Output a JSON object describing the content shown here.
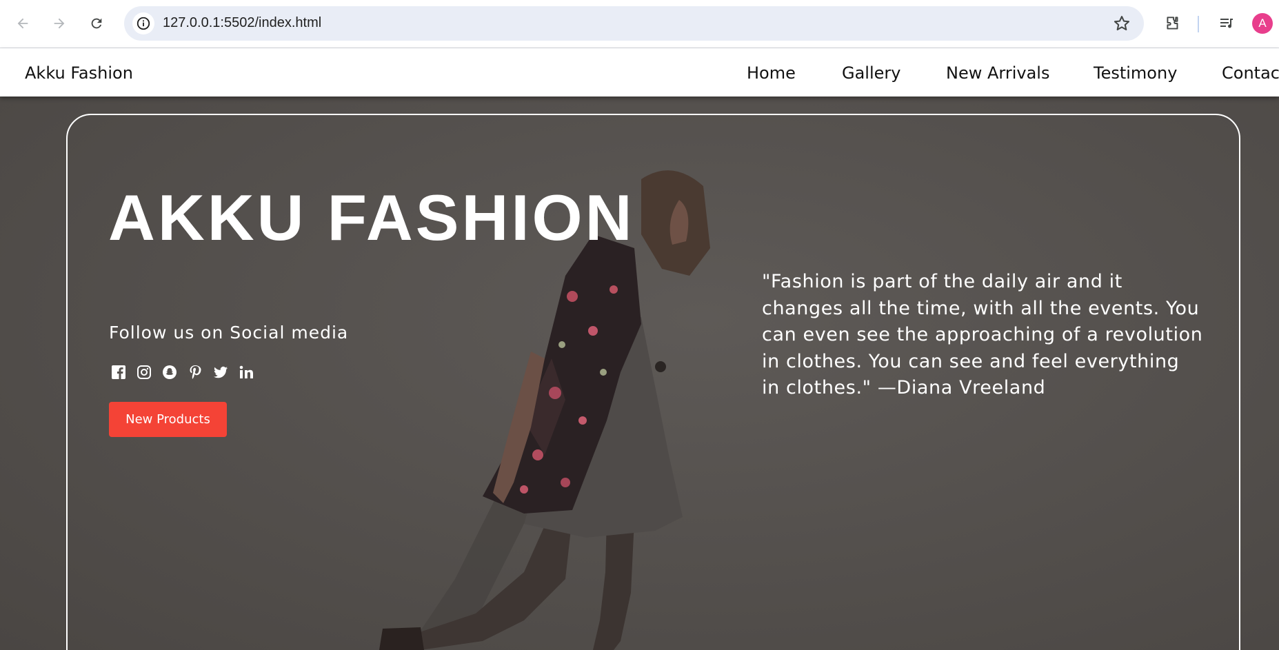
{
  "browser": {
    "url": "127.0.0.1:5502/index.html",
    "profile_initial": "A"
  },
  "navbar": {
    "brand": "Akku Fashion",
    "links": [
      {
        "label": "Home"
      },
      {
        "label": "Gallery"
      },
      {
        "label": "New Arrivals"
      },
      {
        "label": "Testimony"
      },
      {
        "label": "Contact"
      }
    ]
  },
  "hero": {
    "title": "AKKU FASHION",
    "follow_text": "Follow us on Social media",
    "social_icons": [
      "facebook-icon",
      "instagram-icon",
      "snapchat-icon",
      "pinterest-icon",
      "twitter-icon",
      "linkedin-icon"
    ],
    "cta_label": "New Products",
    "quote": "\"Fashion is part of the daily air and it changes all the time, with all the events. You can even see the approaching of a revolution in clothes. You can see and feel everything in clothes.\" —Diana Vreeland"
  },
  "colors": {
    "accent": "#f44336",
    "hero_bg": "#55514e",
    "text_on_hero": "#ffffff",
    "profile": "#e83e8c"
  }
}
